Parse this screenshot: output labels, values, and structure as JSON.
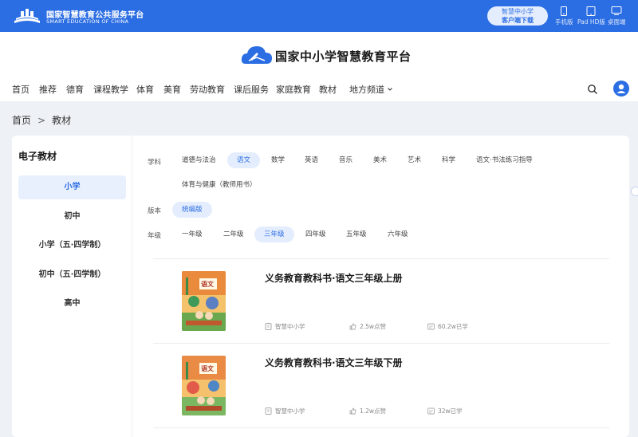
{
  "topbar": {
    "platform_name": "国家智慧教育公共服务平台",
    "platform_name_en": "SMART EDUCATION OF CHINA",
    "client_button": {
      "line1": "智慧中小学",
      "line2": "客户端下载"
    },
    "devices": [
      {
        "label": "手机版",
        "icon": "phone-icon"
      },
      {
        "label": "Pad HD版",
        "icon": "tablet-icon"
      },
      {
        "label": "桌面端",
        "icon": "desktop-icon"
      }
    ]
  },
  "header": {
    "site_name": "国家中小学智慧教育平台",
    "nav": [
      {
        "label": "首页"
      },
      {
        "label": "推荐"
      },
      {
        "label": "德育"
      },
      {
        "label": "课程教学"
      },
      {
        "label": "体育"
      },
      {
        "label": "美育"
      },
      {
        "label": "劳动教育"
      },
      {
        "label": "课后服务"
      },
      {
        "label": "家庭教育"
      },
      {
        "label": "教材"
      },
      {
        "label": "地方频道"
      }
    ]
  },
  "breadcrumb": {
    "home": "首页",
    "separator": ">",
    "current": "教材"
  },
  "sidebar": {
    "title": "电子教材",
    "items": [
      {
        "label": "小学",
        "active": true
      },
      {
        "label": "初中",
        "active": false
      },
      {
        "label": "小学（五·四学制）",
        "active": false
      },
      {
        "label": "初中（五·四学制）",
        "active": false
      },
      {
        "label": "高中",
        "active": false
      }
    ]
  },
  "filters": {
    "subject": {
      "label": "学科",
      "options": [
        "道德与法治",
        "语文",
        "数学",
        "英语",
        "音乐",
        "美术",
        "艺术",
        "科学",
        "语文·书法练习指导",
        "体育与健康（教师用书）"
      ],
      "selected": "语文"
    },
    "edition": {
      "label": "版本",
      "options": [
        "统编版"
      ],
      "selected": "统编版"
    },
    "grade": {
      "label": "年级",
      "options": [
        "一年级",
        "二年级",
        "三年级",
        "四年级",
        "五年级",
        "六年级"
      ],
      "selected": "三年级"
    }
  },
  "books": [
    {
      "title": "义务教育教科书·语文三年级上册",
      "publisher": "智慧中小学",
      "likes": "2.5w点赞",
      "learners": "60.2w已学",
      "cover_label": "语文"
    },
    {
      "title": "义务教育教科书·语文三年级下册",
      "publisher": "智慧中小学",
      "likes": "1.2w点赞",
      "learners": "32w已学",
      "cover_label": "语文"
    }
  ],
  "colors": {
    "brand_blue": "#2b6de3",
    "selected_bg": "#e4edfd",
    "page_bg": "#eef1f6"
  }
}
